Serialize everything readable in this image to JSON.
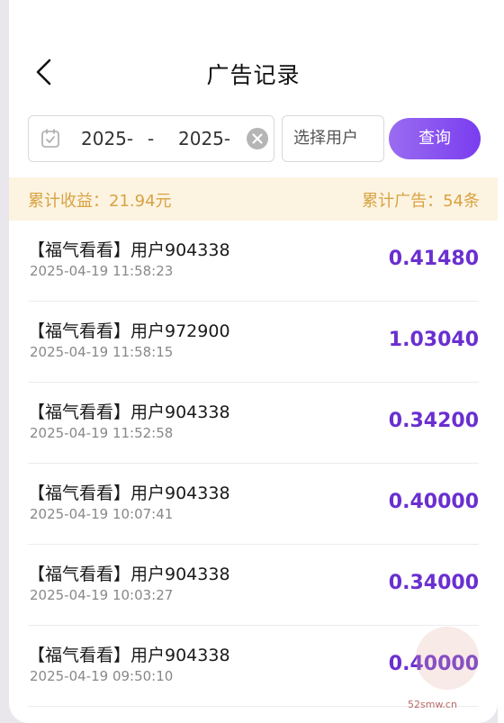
{
  "header": {
    "title": "广告记录"
  },
  "filter": {
    "date_start": "2025-",
    "date_separator": "-",
    "date_end": "2025-",
    "user_placeholder": "选择用户",
    "query_label": "查询"
  },
  "summary": {
    "total_income": "累计收益：21.94元",
    "total_ads": "累计广告：54条"
  },
  "records": [
    {
      "name": "【福气看看】用户904338",
      "time": "2025-04-19 11:58:23",
      "amount": "0.41480"
    },
    {
      "name": "【福气看看】用户972900",
      "time": "2025-04-19 11:58:15",
      "amount": "1.03040"
    },
    {
      "name": "【福气看看】用户904338",
      "time": "2025-04-19 11:52:58",
      "amount": "0.34200"
    },
    {
      "name": "【福气看看】用户904338",
      "time": "2025-04-19 10:07:41",
      "amount": "0.40000"
    },
    {
      "name": "【福气看看】用户904338",
      "time": "2025-04-19 10:03:27",
      "amount": "0.34000"
    },
    {
      "name": "【福气看看】用户904338",
      "time": "2025-04-19 09:50:10",
      "amount": "0.40000"
    }
  ],
  "watermark": {
    "text": "52smw.cn"
  },
  "colors": {
    "accent": "#7a3df0",
    "amount": "#6a2fd0",
    "summary_bg": "#fdf3e1",
    "summary_text": "#d7a342"
  },
  "icons": {
    "back": "back-arrow-icon",
    "calendar": "calendar-icon",
    "clear": "clear-icon"
  }
}
